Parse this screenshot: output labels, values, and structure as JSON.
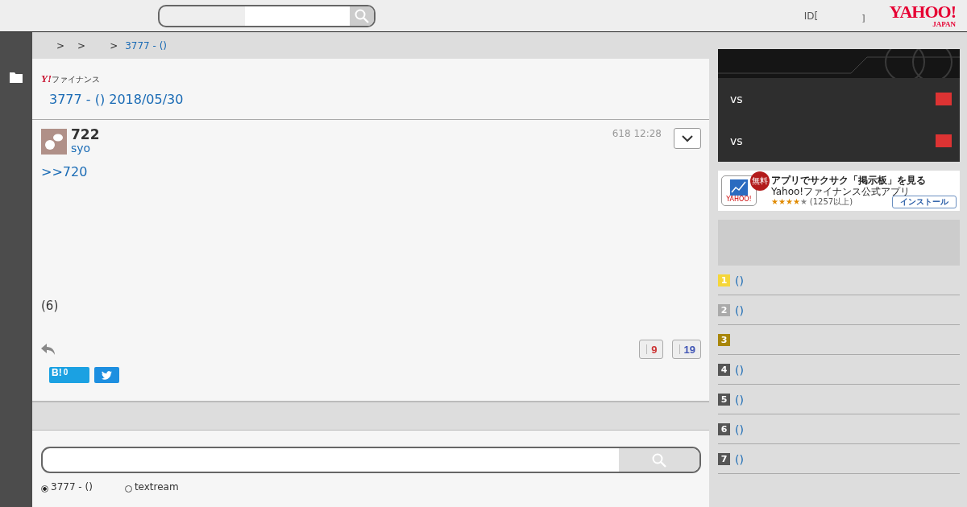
{
  "header": {
    "account": {
      "prefix": "ID[",
      "suffix": "]"
    },
    "logo": {
      "main": "YAHOO!",
      "sub": "JAPAN"
    }
  },
  "breadcrumb": {
    "separators": [
      ">",
      ">",
      ">"
    ],
    "current": "3777 - ()"
  },
  "board": {
    "brand_mark": "Y!",
    "brand_name": "ファイナンス",
    "title": "3777 - () 2018/05/30"
  },
  "post": {
    "number": "722",
    "author": "syo",
    "time": "618 12:28",
    "reply_to": ">>720",
    "body": "(6)",
    "votes": [
      {
        "kind": "like",
        "count": "9"
      },
      {
        "kind": "dislike",
        "count": "19"
      }
    ],
    "hatena_label": "B!",
    "hatena_count": "0"
  },
  "search": {
    "options": [
      {
        "label": "3777 - ()",
        "selected": true
      },
      {
        "label": "textream",
        "selected": false
      }
    ]
  },
  "games": [
    {
      "vs": "vs"
    },
    {
      "vs": "vs"
    }
  ],
  "app_ad": {
    "badge": "無料",
    "headline": "アプリでサクサク「掲示板」を見る",
    "app_name": "Yahoo!ファイナンス公式アプリ",
    "stars": 4,
    "reviews": "(1257以上)",
    "install": "インストール",
    "icon_label": "YAHOO!"
  },
  "ranking": [
    {
      "rank": "1",
      "color": "#f5d63a",
      "name": "()"
    },
    {
      "rank": "2",
      "color": "#aaaaaa",
      "name": "()"
    },
    {
      "rank": "3",
      "color": "#a8860b"
    },
    {
      "rank": "4",
      "color": "#555555",
      "name": "()"
    },
    {
      "rank": "5",
      "color": "#555555",
      "name": "()"
    },
    {
      "rank": "6",
      "color": "#555555",
      "name": "()"
    },
    {
      "rank": "7",
      "color": "#555555",
      "name": "()"
    }
  ]
}
